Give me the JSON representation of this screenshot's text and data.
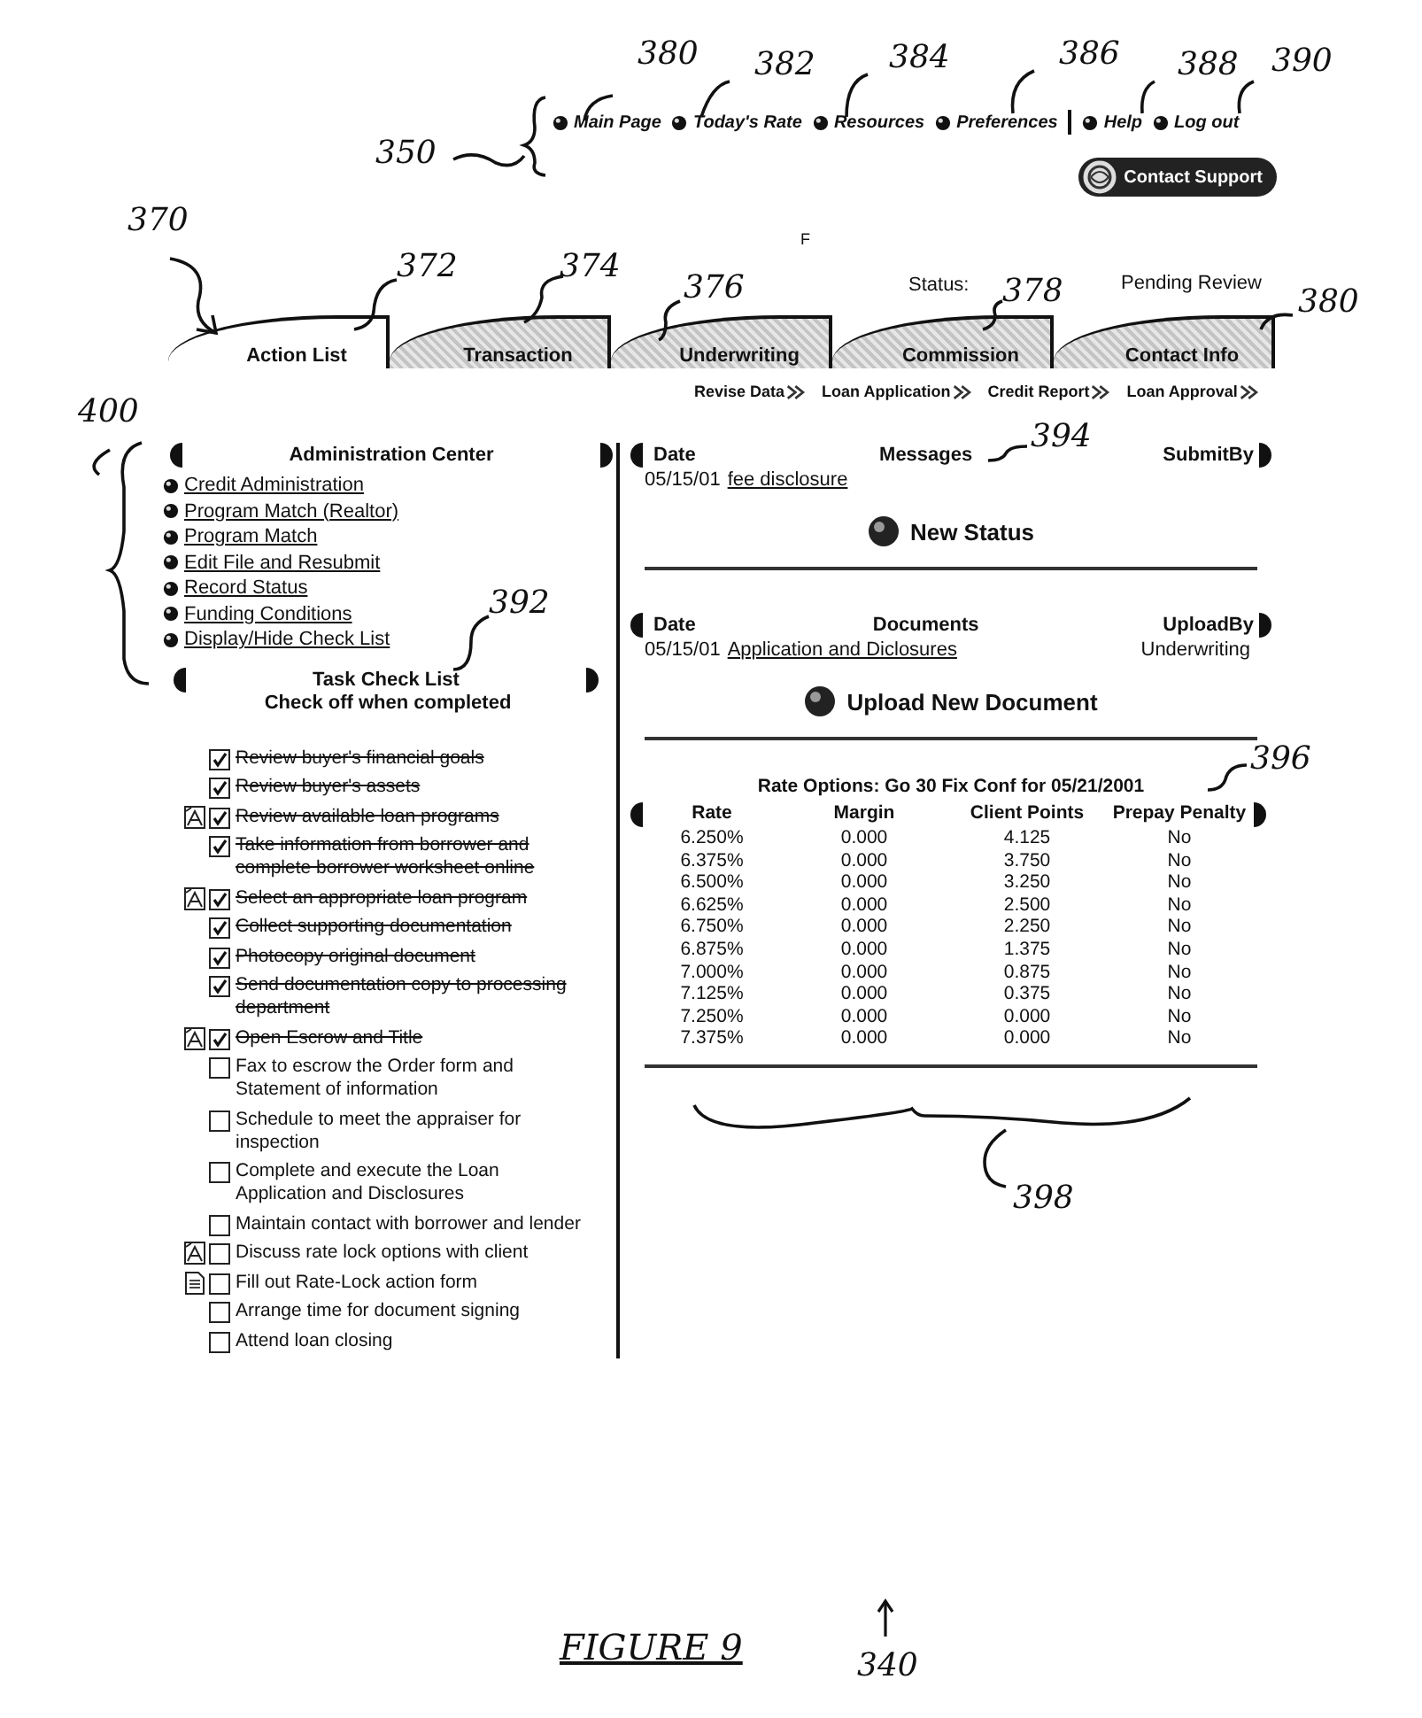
{
  "top_nav": {
    "main": [
      {
        "label": "Main Page"
      },
      {
        "label": "Today's Rate"
      },
      {
        "label": "Resources"
      },
      {
        "label": "Preferences"
      }
    ],
    "help": [
      {
        "label": "Help"
      },
      {
        "label": "Log out"
      }
    ]
  },
  "contact_button": {
    "label": "Contact Support"
  },
  "status": {
    "label": "Status:",
    "value": "Pending Review"
  },
  "tabs": [
    {
      "label": "Action List",
      "selected": true
    },
    {
      "label": "Transaction",
      "selected": false
    },
    {
      "label": "Underwriting",
      "selected": false
    },
    {
      "label": "Commission",
      "selected": false
    },
    {
      "label": "Contact Info",
      "selected": false
    }
  ],
  "sub_links": [
    "Revise Data",
    "Loan Application",
    "Credit Report",
    "Loan Approval"
  ],
  "admin_center": {
    "title": "Administration Center",
    "links": [
      "Credit Administration",
      "Program Match (Realtor)",
      "Program Match",
      "Edit File and Resubmit",
      "Record Status",
      "Funding Conditions",
      "Display/Hide Check List"
    ]
  },
  "task_check_list": {
    "title": "Task Check List",
    "subtitle": "Check off when completed",
    "items": [
      {
        "text": "Review buyer's financial goals",
        "checked": true,
        "kind": "plain"
      },
      {
        "text": "Review buyer's assets",
        "checked": true,
        "kind": "plain"
      },
      {
        "text": "Review available loan programs",
        "checked": true,
        "kind": "pdf"
      },
      {
        "text": "Take information from borrower and complete borrower worksheet online",
        "checked": true,
        "kind": "plain"
      },
      {
        "text": "Select an appropriate loan program",
        "checked": true,
        "kind": "pdf"
      },
      {
        "text": "Collect supporting documentation",
        "checked": true,
        "kind": "plain"
      },
      {
        "text": "Photocopy original document",
        "checked": true,
        "kind": "plain"
      },
      {
        "text": "Send documentation copy to processing department",
        "checked": true,
        "kind": "plain"
      },
      {
        "text": "Open Escrow and Title",
        "checked": true,
        "kind": "pdf"
      },
      {
        "text": "Fax to escrow the Order form and Statement of information",
        "checked": false,
        "kind": "plain"
      },
      {
        "text": "Schedule to meet the appraiser for inspection",
        "checked": false,
        "kind": "plain"
      },
      {
        "text": "Complete and execute the Loan Application and Disclosures",
        "checked": false,
        "kind": "plain"
      },
      {
        "text": "Maintain contact with borrower and lender",
        "checked": false,
        "kind": "plain"
      },
      {
        "text": "Discuss rate lock options with client",
        "checked": false,
        "kind": "pdf"
      },
      {
        "text": "Fill out Rate-Lock action form",
        "checked": false,
        "kind": "form"
      },
      {
        "text": "Arrange time for document signing",
        "checked": false,
        "kind": "plain"
      },
      {
        "text": "Attend loan closing",
        "checked": false,
        "kind": "plain"
      }
    ]
  },
  "messages": {
    "columns": [
      "Date",
      "Messages",
      "SubmitBy"
    ],
    "rows": [
      {
        "date": "05/15/01",
        "message": "fee disclosure"
      }
    ],
    "action": "New Status"
  },
  "documents": {
    "columns": [
      "Date",
      "Documents",
      "UploadBy"
    ],
    "rows": [
      {
        "date": "05/15/01",
        "document": "Application and Diclosures",
        "upload_by": "Underwriting"
      }
    ],
    "action": "Upload New Document"
  },
  "rate_options": {
    "title": "Rate Options: Go 30 Fix Conf for 05/21/2001",
    "columns": [
      "Rate",
      "Margin",
      "Client Points",
      "Prepay Penalty"
    ],
    "rows": [
      [
        "6.250%",
        "0.000",
        "4.125",
        "No"
      ],
      [
        "6.375%",
        "0.000",
        "3.750",
        "No"
      ],
      [
        "6.500%",
        "0.000",
        "3.250",
        "No"
      ],
      [
        "6.625%",
        "0.000",
        "2.500",
        "No"
      ],
      [
        "6.750%",
        "0.000",
        "2.250",
        "No"
      ],
      [
        "6.875%",
        "0.000",
        "1.375",
        "No"
      ],
      [
        "7.000%",
        "0.000",
        "0.875",
        "No"
      ],
      [
        "7.125%",
        "0.000",
        "0.375",
        "No"
      ],
      [
        "7.250%",
        "0.000",
        "0.000",
        "No"
      ],
      [
        "7.375%",
        "0.000",
        "0.000",
        "No"
      ]
    ]
  },
  "annotations": [
    {
      "label": "380",
      "kind": "numeral"
    },
    {
      "label": "382",
      "kind": "numeral"
    },
    {
      "label": "384",
      "kind": "numeral"
    },
    {
      "label": "386",
      "kind": "numeral"
    },
    {
      "label": "388",
      "kind": "numeral"
    },
    {
      "label": "390",
      "kind": "numeral"
    },
    {
      "label": "350",
      "kind": "numeral"
    },
    {
      "label": "370",
      "kind": "numeral"
    },
    {
      "label": "372",
      "kind": "numeral"
    },
    {
      "label": "374",
      "kind": "numeral"
    },
    {
      "label": "376",
      "kind": "numeral"
    },
    {
      "label": "378",
      "kind": "numeral"
    },
    {
      "label": "380",
      "kind": "numeral"
    },
    {
      "label": "400",
      "kind": "numeral"
    },
    {
      "label": "392",
      "kind": "numeral"
    },
    {
      "label": "394",
      "kind": "numeral"
    },
    {
      "label": "396",
      "kind": "numeral"
    },
    {
      "label": "398",
      "kind": "numeral"
    },
    {
      "label": "F",
      "kind": "letter"
    }
  ],
  "figure": {
    "caption": "FIGURE 9",
    "reference": "340"
  }
}
